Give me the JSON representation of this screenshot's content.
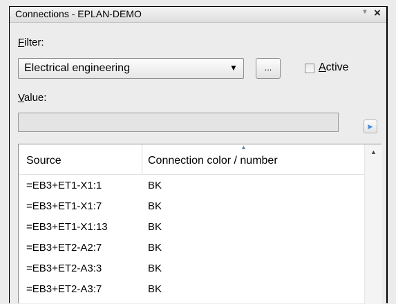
{
  "window": {
    "title": "Connections - EPLAN-DEMO",
    "menu_icon": "dropdown-arrow-icon",
    "close_icon": "close-icon"
  },
  "filter": {
    "label_mnemonic": "F",
    "label_rest": "ilter:",
    "selected": "Electrical engineering",
    "browse_label": "...",
    "active_mnemonic": "A",
    "active_rest": "ctive",
    "active_checked": false
  },
  "value": {
    "label_mnemonic": "V",
    "label_rest": "alue:",
    "text": ""
  },
  "grid": {
    "columns": [
      "Source",
      "Connection color / number"
    ],
    "sorted_column": "Connection color / number",
    "rows": [
      {
        "source": "=EB3+ET1-X1:1",
        "color": "BK"
      },
      {
        "source": "=EB3+ET1-X1:7",
        "color": "BK"
      },
      {
        "source": "=EB3+ET1-X1:13",
        "color": "BK"
      },
      {
        "source": "=EB3+ET2-A2:7",
        "color": "BK"
      },
      {
        "source": "=EB3+ET2-A3:3",
        "color": "BK"
      },
      {
        "source": "=EB3+ET2-A3:7",
        "color": "BK"
      }
    ]
  }
}
